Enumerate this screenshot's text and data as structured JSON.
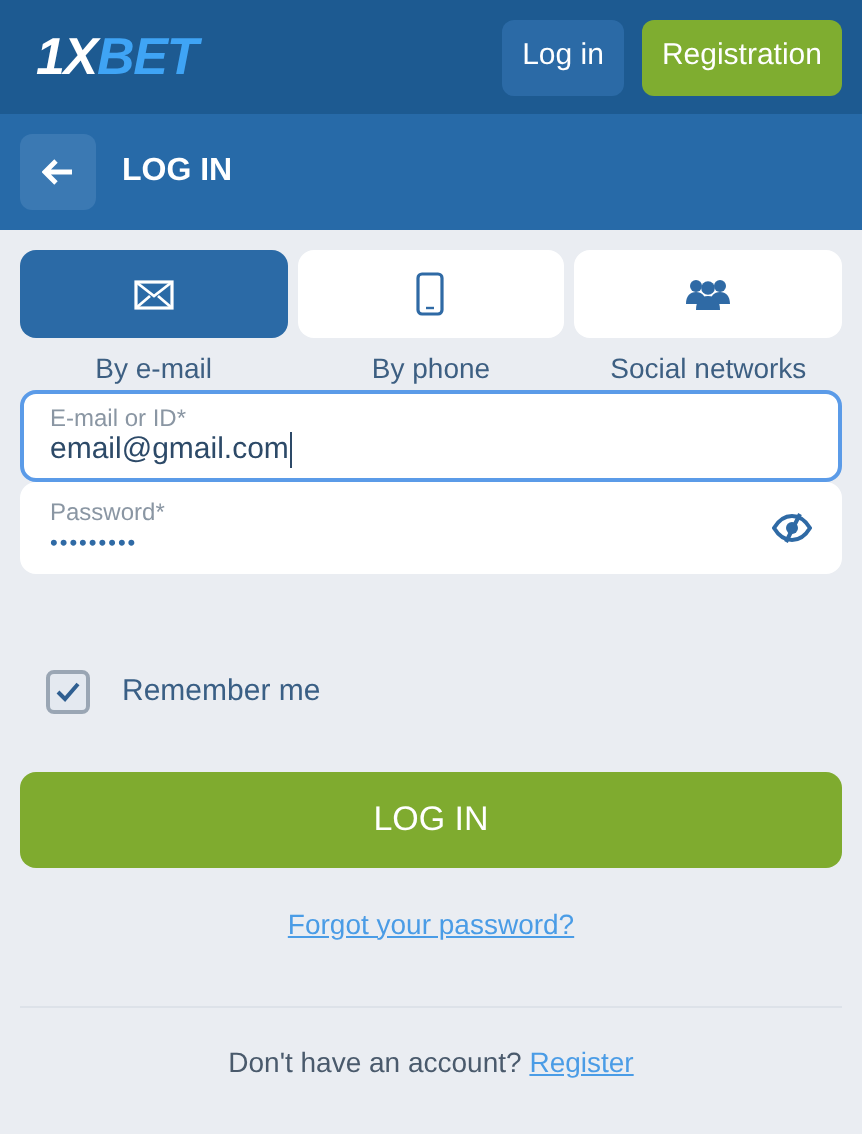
{
  "header": {
    "logo": {
      "lead": "1X",
      "rest": "BET"
    },
    "login_button": "Log in",
    "registration_button": "Registration"
  },
  "title_bar": {
    "title": "LOG IN"
  },
  "tabs": [
    {
      "label": "By e-mail",
      "selected": true
    },
    {
      "label": "By phone",
      "selected": false
    },
    {
      "label": "Social networks",
      "selected": false
    }
  ],
  "email_field": {
    "label": "E-mail or ID*",
    "value": "email@gmail.com",
    "focused": true
  },
  "password_field": {
    "label": "Password*",
    "value": "•••••••••",
    "focused": false
  },
  "remember_me": {
    "label": "Remember me",
    "checked": true
  },
  "submit_button": "LOG IN",
  "forgot_link": "Forgot your password?",
  "footer": {
    "text": "Don't have an account?",
    "link": "Register"
  }
}
